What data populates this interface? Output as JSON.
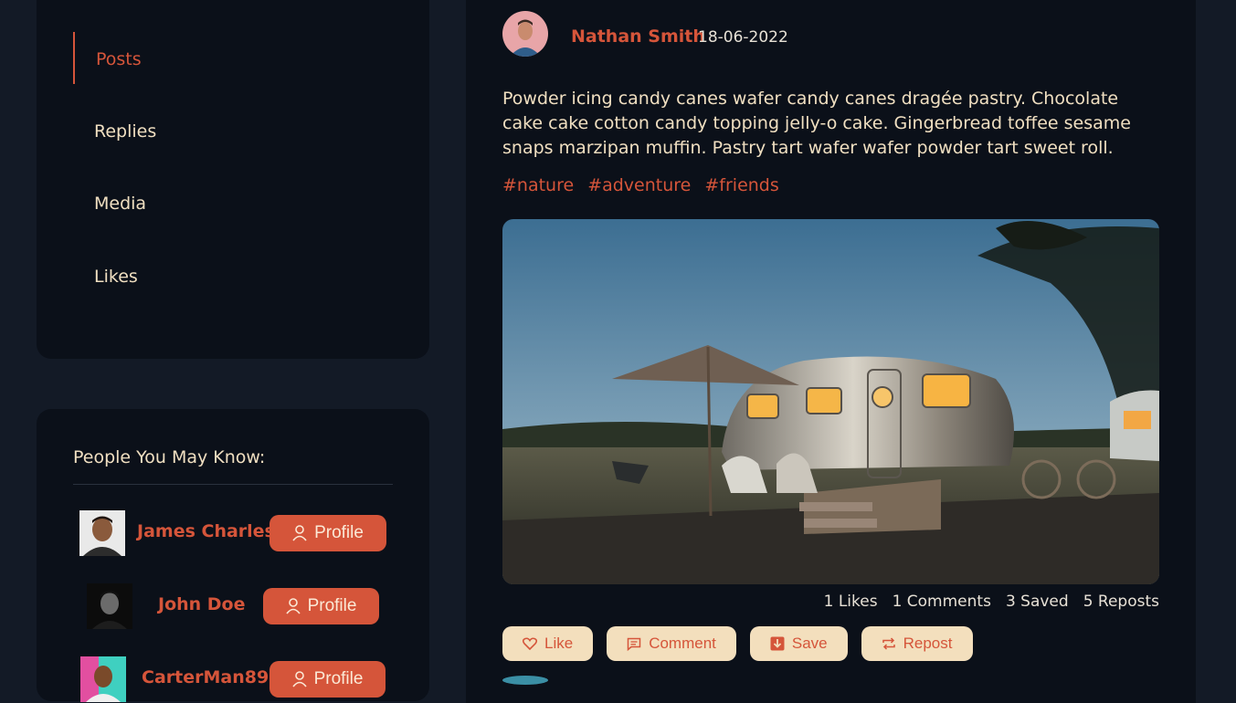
{
  "nav": {
    "items": [
      {
        "label": "Posts",
        "active": true
      },
      {
        "label": "Replies",
        "active": false
      },
      {
        "label": "Media",
        "active": false
      },
      {
        "label": "Likes",
        "active": false
      }
    ]
  },
  "people": {
    "title": "People You May Know:",
    "list": [
      {
        "name": "James Charles",
        "button": "Profile"
      },
      {
        "name": "John Doe",
        "button": "Profile"
      },
      {
        "name": "CarterMan89",
        "button": "Profile"
      }
    ]
  },
  "post": {
    "author": "Nathan Smith",
    "date": "18-06-2022",
    "text": "Powder icing candy canes wafer candy canes dragée pastry. Chocolate cake cake cotton candy topping jelly-o cake. Gingerbread toffee sesame snaps marzipan muffin. Pastry tart wafer wafer powder tart sweet roll.",
    "hashtags": [
      "#nature",
      "#adventure",
      "#friends"
    ],
    "stats": {
      "likes": "1 Likes",
      "comments": "1 Comments",
      "saved": "3 Saved",
      "reposts": "5 Reposts"
    },
    "actions": {
      "like": "Like",
      "comment": "Comment",
      "save": "Save",
      "repost": "Repost"
    }
  },
  "colors": {
    "accent": "#d5553a",
    "background": "#131a26",
    "card": "#0b1019",
    "text": "#f0dfc1",
    "button_light": "#f3dfbd"
  },
  "icons": [
    "user-icon",
    "heart-icon",
    "comment-icon",
    "bookmark-icon",
    "repost-icon"
  ]
}
